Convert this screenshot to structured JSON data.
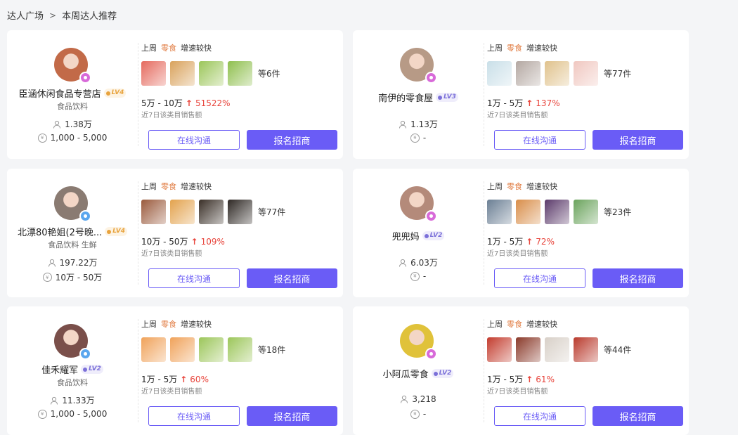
{
  "breadcrumb": {
    "parent": "达人广场",
    "current": "本周达人推荐"
  },
  "common": {
    "tag_last_week": "上周",
    "tag_category": "零食",
    "tag_trend": "增速较快",
    "sales_label": "近7日该类目销售额",
    "btn_chat": "在线沟通",
    "btn_signup": "报名招商"
  },
  "colors": {
    "accent": "#6a5cf6",
    "growth": "#e8433a",
    "category_tag": "#e07a3f"
  },
  "cards": [
    {
      "name": "臣涵休闲食品专营店",
      "level": "LV4",
      "category": "食品饮料",
      "fans": "1.38万",
      "price_range": "1,000 - 5,000",
      "items_count": "等6件",
      "sales_range": "5万 - 10万",
      "growth": "51522%",
      "badge_color": "#d86ad9",
      "avatar_color": "#c26a48",
      "thumb_colors": [
        "#e56a5e",
        "#d9a25c",
        "#9cc65a",
        "#8fbf4e"
      ],
      "icons": {
        "fans": "person-icon",
        "price": "coin-icon",
        "trend": "arrow-up-icon"
      }
    },
    {
      "name": "南伊的零食屋",
      "level": "LV3",
      "category": "",
      "fans": "1.13万",
      "price_range": "-",
      "items_count": "等77件",
      "sales_range": "1万 - 5万",
      "growth": "137%",
      "badge_color": "#d86ad9",
      "avatar_color": "#b79a86",
      "thumb_colors": [
        "#c9dfe8",
        "#b4a8a2",
        "#e0c28c",
        "#f0c7c0"
      ],
      "icons": {
        "fans": "person-icon",
        "price": "coin-icon",
        "trend": "arrow-up-icon"
      }
    },
    {
      "name": "北漂80艳姐(2号晚...",
      "level": "LV4",
      "category": "食品饮料 生鲜",
      "fans": "197.22万",
      "price_range": "10万 - 50万",
      "items_count": "等77件",
      "sales_range": "10万 - 50万",
      "growth": "109%",
      "badge_color": "#5aa6ee",
      "avatar_color": "#8a7b72",
      "thumb_colors": [
        "#9a5a3c",
        "#e3a24d",
        "#3a2f27",
        "#2e2824"
      ],
      "icons": {
        "fans": "person-icon",
        "price": "coin-icon",
        "trend": "arrow-up-icon"
      }
    },
    {
      "name": "兜兜妈",
      "level": "LV2",
      "category": "",
      "fans": "6.03万",
      "price_range": "-",
      "items_count": "等23件",
      "sales_range": "1万 - 5万",
      "growth": "72%",
      "badge_color": "#d86ad9",
      "avatar_color": "#b48a7a",
      "thumb_colors": [
        "#6b7f94",
        "#d98e4a",
        "#5c3b6b",
        "#6aa35c"
      ],
      "icons": {
        "fans": "person-icon",
        "price": "coin-icon",
        "trend": "arrow-up-icon"
      }
    },
    {
      "name": "佳禾耀军",
      "level": "LV2",
      "category": "食品饮料",
      "fans": "11.33万",
      "price_range": "1,000 - 5,000",
      "items_count": "等18件",
      "sales_range": "1万 - 5万",
      "growth": "60%",
      "badge_color": "#5aa6ee",
      "avatar_color": "#7a4f4a",
      "thumb_colors": [
        "#f0a25a",
        "#f0a25a",
        "#9cc65a",
        "#9cc65a"
      ],
      "icons": {
        "fans": "person-icon",
        "price": "coin-icon",
        "trend": "arrow-up-icon"
      }
    },
    {
      "name": "小阿瓜零食",
      "level": "LV2",
      "category": "",
      "fans": "3,218",
      "price_range": "-",
      "items_count": "等44件",
      "sales_range": "1万 - 5万",
      "growth": "61%",
      "badge_color": "#d86ad9",
      "avatar_color": "#e0c23a",
      "thumb_colors": [
        "#c33c2e",
        "#8a3a2a",
        "#d8d0c8",
        "#b93a2c"
      ],
      "icons": {
        "fans": "person-icon",
        "price": "coin-icon",
        "trend": "arrow-up-icon"
      }
    }
  ]
}
